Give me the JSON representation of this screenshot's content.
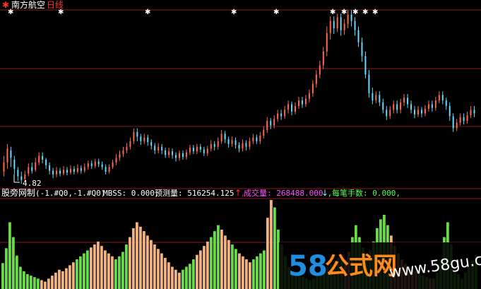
{
  "header": {
    "stock_name": "南方航空",
    "period": "日线"
  },
  "price_marker": {
    "label": "4.82"
  },
  "indicator_bar": {
    "name": "股旁网制",
    "params": "(-1.#Q0,-1.#Q0)",
    "mbss": "MBSS: 0.000,",
    "forecast": "预测量: 516254.125",
    "forecast_arrow": "↑,",
    "volume": "成交量: 268488.000",
    "volume_arrow": "↓,",
    "per_trade": "每笔手数: 0.000,"
  },
  "watermark": {
    "digits": "58",
    "chinese": "公式网",
    "url": "www.58gu.com"
  },
  "colors": {
    "background": "#000000",
    "grid": "#8b1a1a",
    "up": "#ff6a4d",
    "down": "#66d9ff",
    "up_bar": "#f2b27a",
    "down_bar": "#66dd44",
    "white": "#ffffff",
    "yellow": "#ffff00",
    "magenta": "#ff55ff",
    "cyan": "#55ffff",
    "green": "#55ff55",
    "red": "#ff3030",
    "wm_blue": "#1e8fe0",
    "wm_orange": "#ff8a1a"
  },
  "chart_data": {
    "type": "candlestick_with_volume",
    "price_min": 4.82,
    "markers_x": [
      14,
      85,
      208,
      330,
      390,
      470,
      486,
      502,
      516,
      530
    ],
    "candles": [
      [
        4.95,
        5.05,
        5.12,
        4.9
      ],
      [
        5.05,
        5.2,
        5.25,
        4.98
      ],
      [
        5.18,
        5.1,
        5.22,
        5.0
      ],
      [
        5.08,
        4.98,
        5.12,
        4.92
      ],
      [
        4.97,
        4.9,
        5.0,
        4.85
      ],
      [
        4.9,
        4.86,
        4.95,
        4.82
      ],
      [
        4.87,
        4.92,
        4.96,
        4.84
      ],
      [
        4.93,
        5.0,
        5.04,
        4.9
      ],
      [
        5.0,
        4.96,
        5.05,
        4.93
      ],
      [
        4.97,
        5.05,
        5.1,
        4.95
      ],
      [
        5.05,
        5.12,
        5.16,
        5.02
      ],
      [
        5.12,
        5.08,
        5.16,
        5.04
      ],
      [
        5.08,
        5.02,
        5.1,
        4.98
      ],
      [
        5.02,
        4.96,
        5.05,
        4.92
      ],
      [
        4.96,
        4.92,
        4.99,
        4.88
      ],
      [
        4.92,
        4.96,
        5.0,
        4.89
      ],
      [
        4.96,
        4.93,
        4.99,
        4.9
      ],
      [
        4.93,
        4.97,
        5.01,
        4.91
      ],
      [
        4.97,
        4.94,
        5.0,
        4.91
      ],
      [
        4.94,
        4.98,
        5.02,
        4.92
      ],
      [
        4.98,
        4.95,
        5.01,
        4.92
      ],
      [
        4.95,
        4.99,
        5.03,
        4.93
      ],
      [
        4.99,
        4.96,
        5.02,
        4.93
      ],
      [
        4.96,
        5.0,
        5.04,
        4.94
      ],
      [
        5.0,
        5.04,
        5.07,
        4.97
      ],
      [
        5.04,
        5.01,
        5.07,
        4.98
      ],
      [
        5.01,
        5.06,
        5.09,
        4.99
      ],
      [
        5.06,
        5.03,
        5.09,
        5.0
      ],
      [
        5.03,
        5.0,
        5.06,
        4.97
      ],
      [
        5.0,
        4.95,
        5.03,
        4.92
      ],
      [
        4.95,
        5.0,
        5.03,
        4.93
      ],
      [
        5.0,
        5.05,
        5.08,
        4.98
      ],
      [
        5.05,
        5.1,
        5.14,
        5.02
      ],
      [
        5.1,
        5.14,
        5.18,
        5.07
      ],
      [
        5.14,
        5.18,
        5.22,
        5.11
      ],
      [
        5.18,
        5.22,
        5.26,
        5.15
      ],
      [
        5.22,
        5.28,
        5.32,
        5.19
      ],
      [
        5.28,
        5.38,
        5.42,
        5.25
      ],
      [
        5.38,
        5.33,
        5.42,
        5.28
      ],
      [
        5.33,
        5.28,
        5.36,
        5.24
      ],
      [
        5.28,
        5.32,
        5.36,
        5.25
      ],
      [
        5.32,
        5.27,
        5.35,
        5.23
      ],
      [
        5.27,
        5.23,
        5.3,
        5.19
      ],
      [
        5.23,
        5.18,
        5.26,
        5.14
      ],
      [
        5.18,
        5.22,
        5.26,
        5.15
      ],
      [
        5.22,
        5.18,
        5.25,
        5.14
      ],
      [
        5.18,
        5.13,
        5.21,
        5.1
      ],
      [
        5.13,
        5.17,
        5.21,
        5.1
      ],
      [
        5.17,
        5.13,
        5.2,
        5.09
      ],
      [
        5.13,
        5.1,
        5.16,
        5.06
      ],
      [
        5.1,
        5.15,
        5.18,
        5.07
      ],
      [
        5.15,
        5.11,
        5.18,
        5.08
      ],
      [
        5.11,
        5.16,
        5.19,
        5.08
      ],
      [
        5.16,
        5.21,
        5.24,
        5.13
      ],
      [
        5.21,
        5.17,
        5.24,
        5.14
      ],
      [
        5.17,
        5.22,
        5.25,
        5.14
      ],
      [
        5.22,
        5.19,
        5.25,
        5.16
      ],
      [
        5.19,
        5.15,
        5.22,
        5.12
      ],
      [
        5.15,
        5.2,
        5.23,
        5.12
      ],
      [
        5.2,
        5.25,
        5.29,
        5.17
      ],
      [
        5.25,
        5.22,
        5.28,
        5.18
      ],
      [
        5.22,
        5.28,
        5.32,
        5.19
      ],
      [
        5.28,
        5.36,
        5.4,
        5.25
      ],
      [
        5.36,
        5.3,
        5.39,
        5.26
      ],
      [
        5.3,
        5.25,
        5.33,
        5.21
      ],
      [
        5.25,
        5.29,
        5.33,
        5.22
      ],
      [
        5.29,
        5.24,
        5.32,
        5.2
      ],
      [
        5.24,
        5.2,
        5.27,
        5.16
      ],
      [
        5.2,
        5.26,
        5.3,
        5.17
      ],
      [
        5.26,
        5.22,
        5.29,
        5.18
      ],
      [
        5.22,
        5.28,
        5.32,
        5.19
      ],
      [
        5.28,
        5.32,
        5.36,
        5.25
      ],
      [
        5.32,
        5.28,
        5.35,
        5.25
      ],
      [
        5.28,
        5.34,
        5.38,
        5.25
      ],
      [
        5.34,
        5.4,
        5.44,
        5.31
      ],
      [
        5.4,
        5.5,
        5.54,
        5.37
      ],
      [
        5.5,
        5.45,
        5.53,
        5.41
      ],
      [
        5.45,
        5.52,
        5.56,
        5.42
      ],
      [
        5.52,
        5.58,
        5.62,
        5.49
      ],
      [
        5.58,
        5.55,
        5.62,
        5.51
      ],
      [
        5.55,
        5.62,
        5.66,
        5.52
      ],
      [
        5.62,
        5.68,
        5.72,
        5.58
      ],
      [
        5.68,
        5.6,
        5.71,
        5.56
      ],
      [
        5.6,
        5.66,
        5.7,
        5.57
      ],
      [
        5.66,
        5.72,
        5.76,
        5.63
      ],
      [
        5.72,
        5.68,
        5.76,
        5.64
      ],
      [
        5.68,
        5.74,
        5.78,
        5.65
      ],
      [
        5.74,
        5.8,
        5.84,
        5.7
      ],
      [
        5.8,
        5.9,
        5.94,
        5.76
      ],
      [
        5.9,
        6.0,
        6.05,
        5.86
      ],
      [
        6.0,
        6.1,
        6.15,
        5.96
      ],
      [
        6.1,
        6.25,
        6.3,
        6.06
      ],
      [
        6.25,
        6.45,
        6.52,
        6.2
      ],
      [
        6.45,
        6.58,
        6.63,
        6.38
      ],
      [
        6.58,
        6.5,
        6.63,
        6.44
      ],
      [
        6.5,
        6.62,
        6.66,
        6.46
      ],
      [
        6.62,
        6.48,
        6.66,
        6.42
      ],
      [
        6.48,
        6.55,
        6.6,
        6.43
      ],
      [
        6.55,
        6.65,
        6.7,
        6.5
      ],
      [
        6.65,
        6.58,
        6.7,
        6.52
      ],
      [
        6.58,
        6.48,
        6.62,
        6.42
      ],
      [
        6.48,
        6.35,
        6.52,
        6.3
      ],
      [
        6.35,
        6.2,
        6.4,
        6.14
      ],
      [
        6.2,
        6.0,
        6.25,
        5.96
      ],
      [
        6.0,
        5.8,
        6.05,
        5.75
      ],
      [
        5.8,
        5.72,
        5.86,
        5.68
      ],
      [
        5.72,
        5.78,
        5.82,
        5.69
      ],
      [
        5.78,
        5.7,
        5.82,
        5.66
      ],
      [
        5.7,
        5.62,
        5.74,
        5.58
      ],
      [
        5.62,
        5.55,
        5.66,
        5.51
      ],
      [
        5.55,
        5.62,
        5.66,
        5.52
      ],
      [
        5.62,
        5.68,
        5.72,
        5.58
      ],
      [
        5.68,
        5.62,
        5.72,
        5.58
      ],
      [
        5.62,
        5.7,
        5.74,
        5.58
      ],
      [
        5.7,
        5.75,
        5.79,
        5.66
      ],
      [
        5.75,
        5.68,
        5.79,
        5.64
      ],
      [
        5.68,
        5.62,
        5.72,
        5.58
      ],
      [
        5.62,
        5.57,
        5.66,
        5.53
      ],
      [
        5.57,
        5.62,
        5.66,
        5.54
      ],
      [
        5.62,
        5.58,
        5.65,
        5.54
      ],
      [
        5.58,
        5.63,
        5.67,
        5.55
      ],
      [
        5.63,
        5.68,
        5.72,
        5.6
      ],
      [
        5.68,
        5.64,
        5.72,
        5.6
      ],
      [
        5.64,
        5.72,
        5.76,
        5.61
      ],
      [
        5.72,
        5.78,
        5.82,
        5.69
      ],
      [
        5.78,
        5.72,
        5.82,
        5.68
      ],
      [
        5.72,
        5.66,
        5.75,
        5.62
      ],
      [
        5.66,
        5.55,
        5.7,
        5.5
      ],
      [
        5.55,
        5.42,
        5.58,
        5.38
      ],
      [
        5.42,
        5.48,
        5.52,
        5.39
      ],
      [
        5.48,
        5.54,
        5.58,
        5.45
      ],
      [
        5.54,
        5.5,
        5.58,
        5.46
      ],
      [
        5.5,
        5.56,
        5.6,
        5.47
      ],
      [
        5.56,
        5.62,
        5.66,
        5.53
      ],
      [
        5.62,
        5.58,
        5.66,
        5.54
      ]
    ],
    "volume_scale_max": 100,
    "volumes": [
      [
        35,
        1
      ],
      [
        55,
        1
      ],
      [
        90,
        1
      ],
      [
        70,
        1
      ],
      [
        45,
        1
      ],
      [
        30,
        1
      ],
      [
        24,
        1
      ],
      [
        20,
        1
      ],
      [
        18,
        1
      ],
      [
        16,
        1
      ],
      [
        14,
        1
      ],
      [
        12,
        0
      ],
      [
        10,
        0
      ],
      [
        14,
        0
      ],
      [
        18,
        0
      ],
      [
        22,
        0
      ],
      [
        26,
        0
      ],
      [
        24,
        0
      ],
      [
        28,
        0
      ],
      [
        32,
        0
      ],
      [
        36,
        0
      ],
      [
        40,
        1
      ],
      [
        44,
        1
      ],
      [
        48,
        1
      ],
      [
        52,
        1
      ],
      [
        56,
        0
      ],
      [
        60,
        0
      ],
      [
        64,
        0
      ],
      [
        58,
        0
      ],
      [
        52,
        0
      ],
      [
        48,
        0
      ],
      [
        44,
        0
      ],
      [
        40,
        1
      ],
      [
        44,
        1
      ],
      [
        50,
        1
      ],
      [
        60,
        1
      ],
      [
        70,
        0
      ],
      [
        82,
        0
      ],
      [
        90,
        0
      ],
      [
        84,
        0
      ],
      [
        78,
        0
      ],
      [
        72,
        0
      ],
      [
        66,
        0
      ],
      [
        60,
        0
      ],
      [
        54,
        0
      ],
      [
        48,
        0
      ],
      [
        42,
        0
      ],
      [
        36,
        0
      ],
      [
        30,
        0
      ],
      [
        26,
        0
      ],
      [
        22,
        0
      ],
      [
        26,
        1
      ],
      [
        30,
        1
      ],
      [
        34,
        1
      ],
      [
        40,
        1
      ],
      [
        46,
        0
      ],
      [
        52,
        0
      ],
      [
        58,
        0
      ],
      [
        64,
        0
      ],
      [
        70,
        1
      ],
      [
        78,
        1
      ],
      [
        86,
        1
      ],
      [
        80,
        0
      ],
      [
        72,
        0
      ],
      [
        66,
        0
      ],
      [
        60,
        1
      ],
      [
        54,
        1
      ],
      [
        48,
        0
      ],
      [
        44,
        0
      ],
      [
        40,
        0
      ],
      [
        36,
        0
      ],
      [
        40,
        1
      ],
      [
        44,
        1
      ],
      [
        48,
        1
      ],
      [
        52,
        1
      ],
      [
        96,
        0
      ],
      [
        120,
        0
      ],
      [
        110,
        1
      ],
      [
        80,
        1
      ],
      [
        60,
        1
      ],
      [
        44,
        1
      ],
      [
        30,
        1
      ],
      [
        24,
        1
      ],
      [
        20,
        1
      ],
      [
        18,
        1
      ],
      [
        16,
        1
      ],
      [
        14,
        1
      ],
      [
        12,
        1
      ],
      [
        14,
        1
      ],
      [
        18,
        1
      ],
      [
        22,
        1
      ],
      [
        26,
        1
      ],
      [
        30,
        1
      ],
      [
        34,
        1
      ],
      [
        38,
        1
      ],
      [
        42,
        1
      ],
      [
        46,
        1
      ],
      [
        40,
        0
      ],
      [
        50,
        0
      ],
      [
        70,
        1
      ],
      [
        86,
        1
      ],
      [
        70,
        1
      ],
      [
        56,
        1
      ],
      [
        48,
        1
      ],
      [
        52,
        1
      ],
      [
        64,
        1
      ],
      [
        82,
        1
      ],
      [
        94,
        1
      ],
      [
        100,
        1
      ],
      [
        86,
        1
      ],
      [
        72,
        0
      ],
      [
        58,
        0
      ],
      [
        48,
        0
      ],
      [
        40,
        0
      ],
      [
        34,
        0
      ],
      [
        30,
        0
      ],
      [
        26,
        0
      ],
      [
        24,
        0
      ],
      [
        20,
        1
      ],
      [
        18,
        1
      ],
      [
        16,
        1
      ],
      [
        14,
        0
      ],
      [
        14,
        0
      ],
      [
        22,
        1
      ],
      [
        40,
        1
      ],
      [
        70,
        1
      ],
      [
        90,
        1
      ],
      [
        60,
        1
      ],
      [
        30,
        1
      ],
      [
        20,
        1
      ],
      [
        14,
        1
      ],
      [
        22,
        1
      ],
      [
        30,
        1
      ],
      [
        38,
        1
      ],
      [
        46,
        1
      ]
    ]
  }
}
